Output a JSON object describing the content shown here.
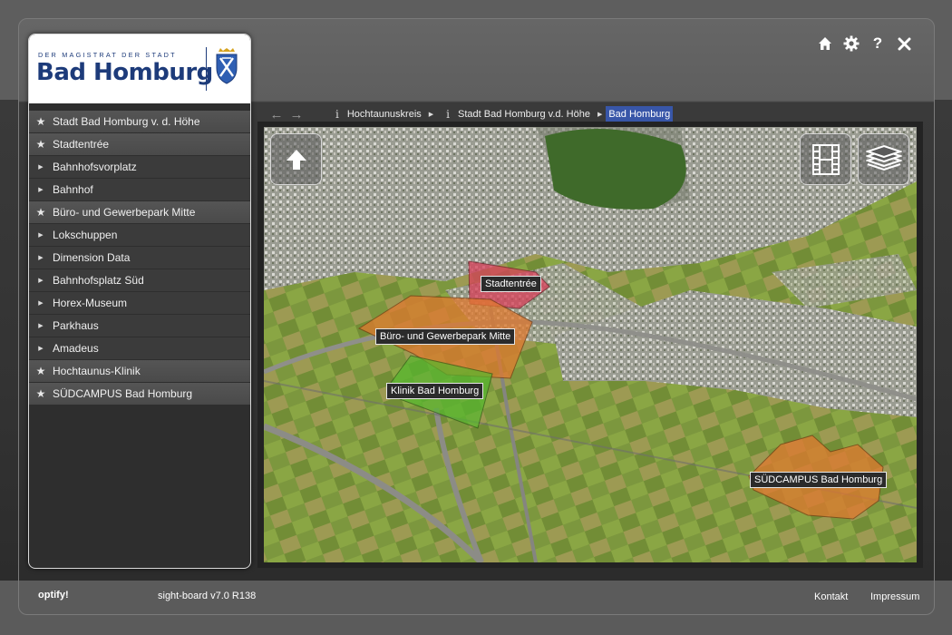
{
  "header": {
    "icons": [
      "home-icon",
      "gear-icon",
      "help-icon",
      "close-icon"
    ],
    "help_glyph": "?"
  },
  "logo": {
    "small_text": "DER MAGISTRAT DER STADT",
    "big_text": "Bad Homburg"
  },
  "sidebar": {
    "items": [
      {
        "label": "Stadt Bad Homburg v. d. Höhe",
        "type": "main"
      },
      {
        "label": "Stadtentrée",
        "type": "main"
      },
      {
        "label": "Bahnhofsvorplatz",
        "type": "sub"
      },
      {
        "label": "Bahnhof",
        "type": "sub"
      },
      {
        "label": "Büro- und Gewerbepark Mitte",
        "type": "main"
      },
      {
        "label": "Lokschuppen",
        "type": "sub"
      },
      {
        "label": "Dimension Data",
        "type": "sub"
      },
      {
        "label": "Bahnhofsplatz Süd",
        "type": "sub"
      },
      {
        "label": "Horex-Museum",
        "type": "sub"
      },
      {
        "label": "Parkhaus",
        "type": "sub"
      },
      {
        "label": "Amadeus",
        "type": "sub"
      },
      {
        "label": "Hochtaunus-Klinik",
        "type": "main"
      },
      {
        "label": "SÜDCAMPUS Bad Homburg",
        "type": "main"
      }
    ]
  },
  "breadcrumb": {
    "items": [
      "Hochtaunuskreis",
      "Stadt Bad Homburg v.d. Höhe",
      "Bad Homburg"
    ],
    "info_glyph": "i"
  },
  "map": {
    "labels": {
      "stadtentree": "Stadtentrée",
      "buero": "Büro- und Gewerbepark Mitte",
      "klinik": "Klinik Bad Homburg",
      "suedcampus": "SÜDCAMPUS Bad Homburg"
    },
    "colors": {
      "highlight_red": "#d9405a",
      "highlight_orange": "#e0792f",
      "highlight_green": "#55b82e"
    }
  },
  "footer": {
    "brand": "optify!",
    "version": "sight-board v7.0 R138",
    "links": [
      "Kontakt",
      "Impressum"
    ]
  }
}
